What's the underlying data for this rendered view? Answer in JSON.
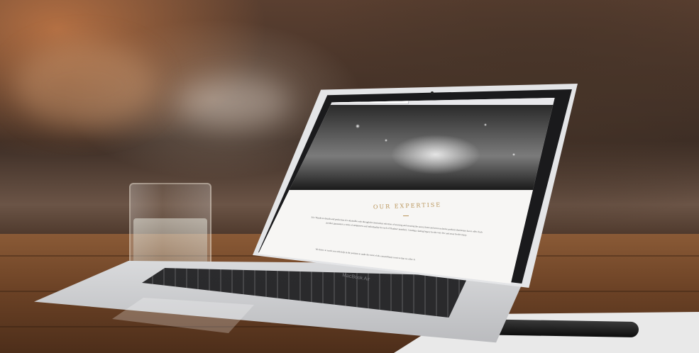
{
  "scene": {
    "laptop_brand": "MacBook Air",
    "website": {
      "heading": "OUR EXPERTISE",
      "paragraph": "It is Thanks to details and perfection it is attainable only through the meticulous selection of sourcing and securing the rarest, finest and most exclusive products that luxury has to offer. Each product guarantees a sense of uniqueness and individuality for each of Thadeus' members. Creating a lasting legacy for the very few and array for the many.",
      "paragraph2": "We thrive to reach you with help in the position to make the most of the extraordinary services that we offer. A"
    }
  }
}
